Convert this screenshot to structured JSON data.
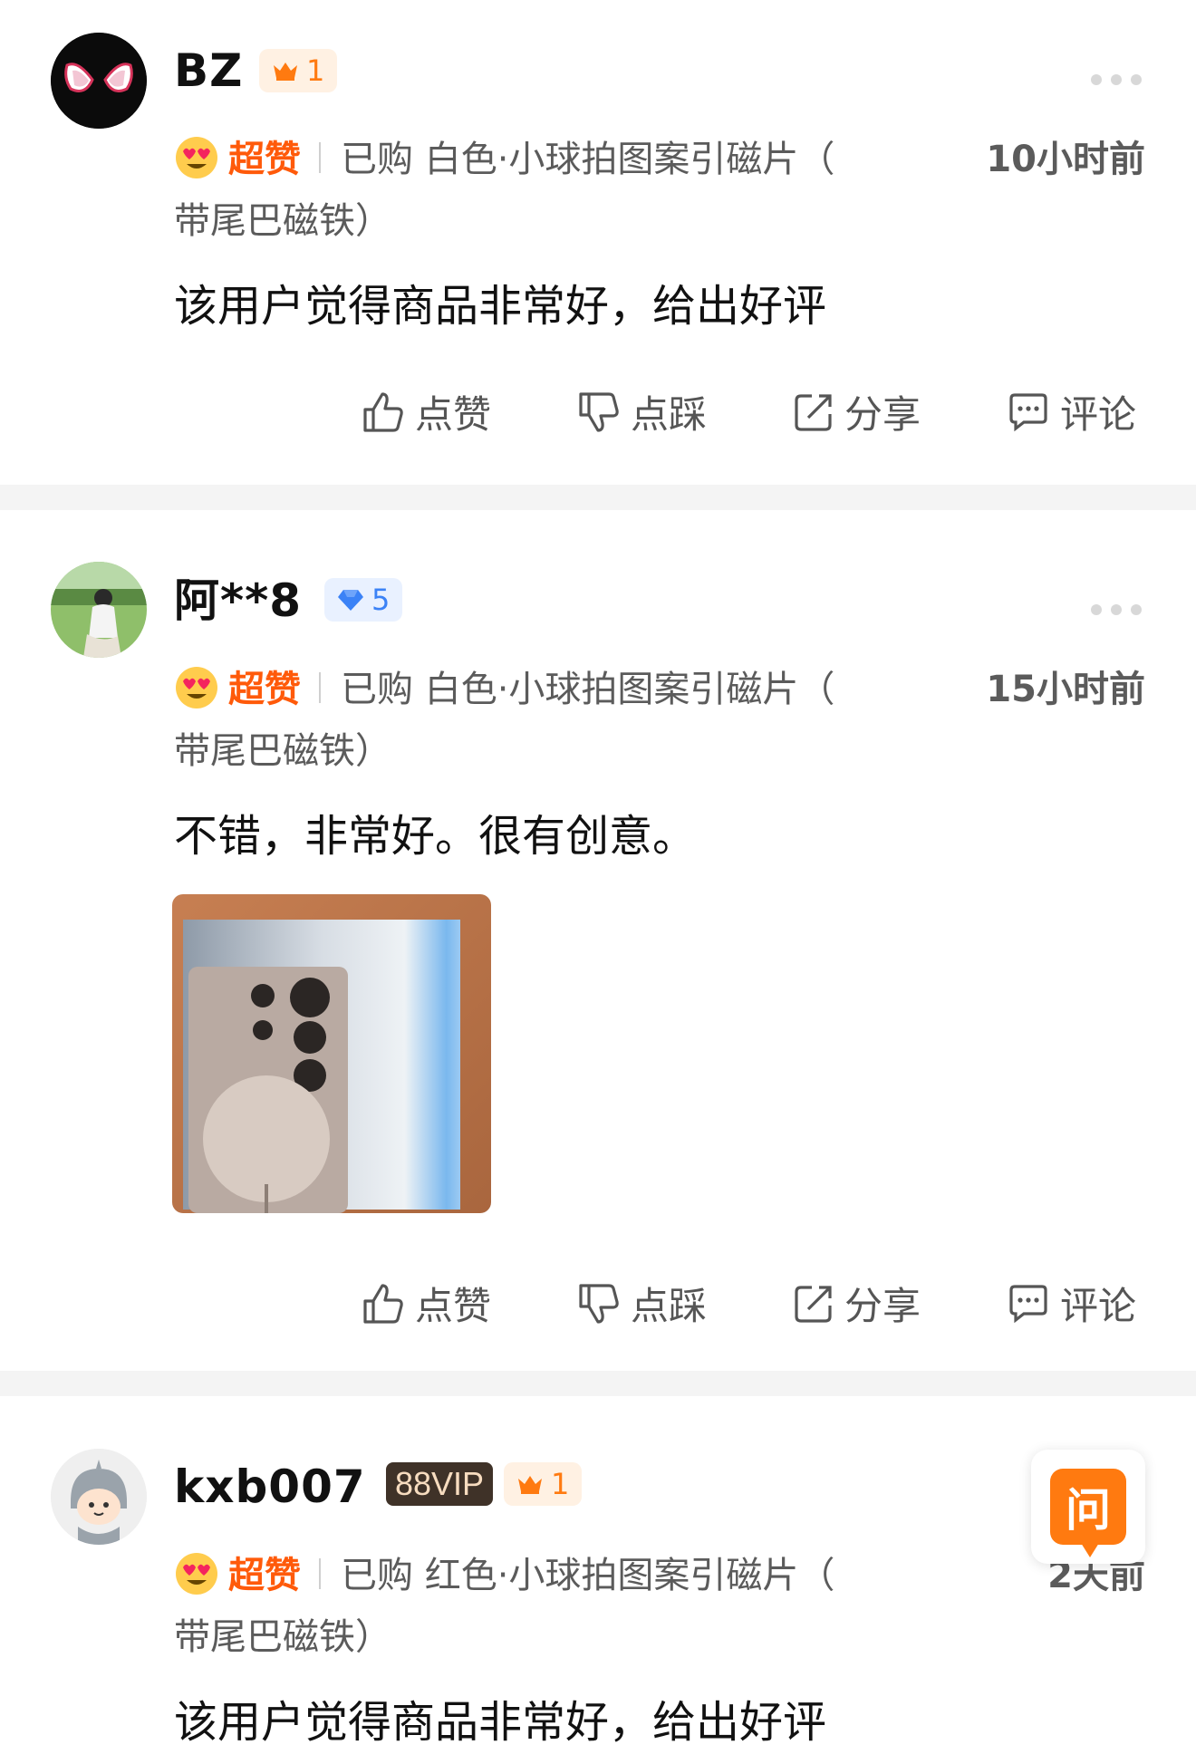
{
  "reviews": [
    {
      "username": "BZ",
      "badges": [
        {
          "type": "crown",
          "text": "1"
        }
      ],
      "rating_label": "超赞",
      "purchase_line1": "已购 白色·小球拍图案引磁片（",
      "purchase_line2": "带尾巴磁铁）",
      "time": "10小时前",
      "content": "该用户觉得商品非常好，给出好评"
    },
    {
      "username": "阿**8",
      "badges": [
        {
          "type": "diamond",
          "text": "5"
        }
      ],
      "rating_label": "超赞",
      "purchase_line1": "已购 白色·小球拍图案引磁片（",
      "purchase_line2": "带尾巴磁铁）",
      "time": "15小时前",
      "content": "不错，非常好。很有创意。",
      "photo_icon": "phone-case-photo"
    },
    {
      "username": "kxb007",
      "badges": [
        {
          "type": "vip",
          "text": "88VIP"
        },
        {
          "type": "crown",
          "text": "1"
        }
      ],
      "rating_label": "超赞",
      "purchase_line1": "已购 红色·小球拍图案引磁片（",
      "purchase_line2": "带尾巴磁铁）",
      "time": "2天前",
      "content": "该用户觉得商品非常好，给出好评"
    }
  ],
  "actions": {
    "like": "点赞",
    "dislike": "点踩",
    "share": "分享",
    "comment": "评论"
  },
  "ask_button": "问",
  "colors": {
    "rating": "#ff5a0a",
    "crown_badge": "#ff7a10",
    "diamond_badge": "#3b82f6",
    "ask_button": "#ff7a10",
    "separator": "#f4f4f4"
  }
}
